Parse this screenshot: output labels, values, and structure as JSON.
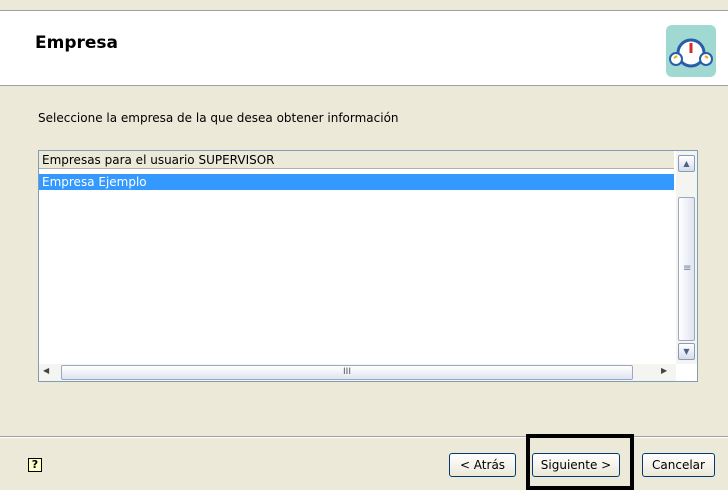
{
  "header": {
    "title": "Empresa",
    "logo_icon": "speedometer-icon"
  },
  "prompt": "Seleccione la empresa de la que desea obtener información",
  "list": {
    "column_header": "Empresas para el usuario SUPERVISOR",
    "rows": [
      "Empresa Ejemplo"
    ],
    "selected_index": 0,
    "selection_color": "#3399ff"
  },
  "scrollbar": {
    "horizontal_thumb_grip": "III",
    "vertical_thumb_grip": "≡"
  },
  "footer": {
    "help_icon": "?",
    "back_label": "< Atrás",
    "next_label": "Siguiente >",
    "cancel_label": "Cancelar"
  }
}
